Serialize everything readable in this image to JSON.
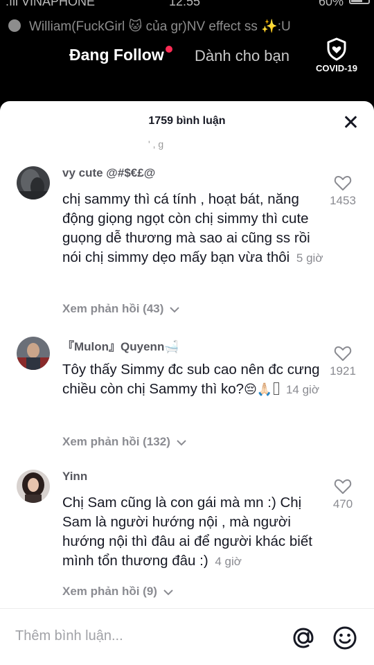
{
  "status_bar": {
    "carrier": ".ıll VINAPHONE",
    "time": "12:55",
    "battery_text": "60%"
  },
  "marquee": {
    "text": "William(FuckGirl 🐱 của gr)NV effect ss ✨:U"
  },
  "feed_tabs": {
    "following": "Đang Follow",
    "for_you": "Dành cho bạn"
  },
  "covid": {
    "label": "COVID-19",
    "icon": "shield-heart-icon"
  },
  "sheet": {
    "title": "1759 bình luận",
    "cut_off_text": "' ,  g"
  },
  "comments": [
    {
      "username": "vy cute @#$€£@",
      "text": "chị sammy thì cá tính , hoạt bát, năng động giọng ngọt còn chị simmy thì cute guọng dễ thương mà sao ai cũng ss rồi nói chị simmy dẹo mấy bạn vừa thôi",
      "time": "5 giờ",
      "likes": "1453",
      "replies": "Xem phản hồi (43)"
    },
    {
      "username": "『Mulon』Quyenn🛁",
      "text": "Tôy thấy Simmy đc sub cao nên đc cưng chiều còn chị Sammy thì ko?",
      "emoji": "😔🙏🏻",
      "time": "14 giờ",
      "likes": "1921",
      "replies": "Xem phản hồi (132)"
    },
    {
      "username": "Yinn",
      "text": "Chị Sam cũng là con gái mà mn :) Chị Sam là người hướng nội , mà người hướng nội thì đâu ai để người khác biết mình tổn thương đâu :)",
      "time": "4 giờ",
      "likes": "470",
      "replies": "Xem phản hồi (9)"
    }
  ],
  "input_bar": {
    "placeholder": "Thêm bình luận...",
    "value": ""
  },
  "colors": {
    "accent": "#fe2c55",
    "text": "#161823",
    "muted": "#8a8b91"
  }
}
